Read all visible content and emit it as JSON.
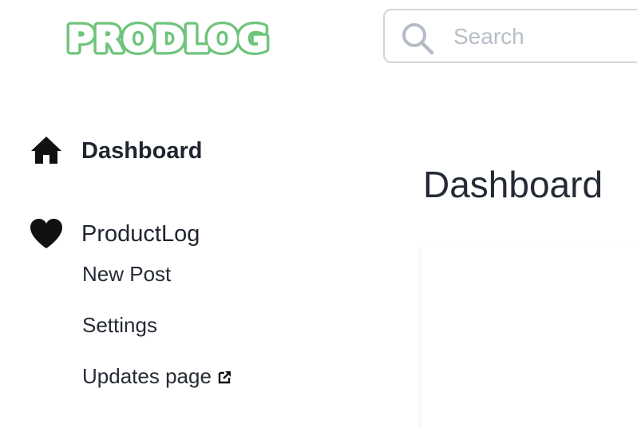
{
  "app": {
    "logo_text": "PRODLOG"
  },
  "search": {
    "placeholder": "Search",
    "value": ""
  },
  "sidebar": {
    "items": [
      {
        "label": "Dashboard",
        "icon": "home-icon",
        "active": true
      },
      {
        "label": "ProductLog",
        "icon": "heart-icon",
        "active": false
      }
    ],
    "sub_items": [
      {
        "label": "New Post"
      },
      {
        "label": "Settings"
      },
      {
        "label": "Updates page",
        "icon": "external-link-icon"
      }
    ]
  },
  "main": {
    "title": "Dashboard"
  },
  "colors": {
    "logo": "#6ec47a",
    "text": "#1f2430",
    "placeholder": "#b8bec8",
    "border": "#d2d6dc"
  }
}
